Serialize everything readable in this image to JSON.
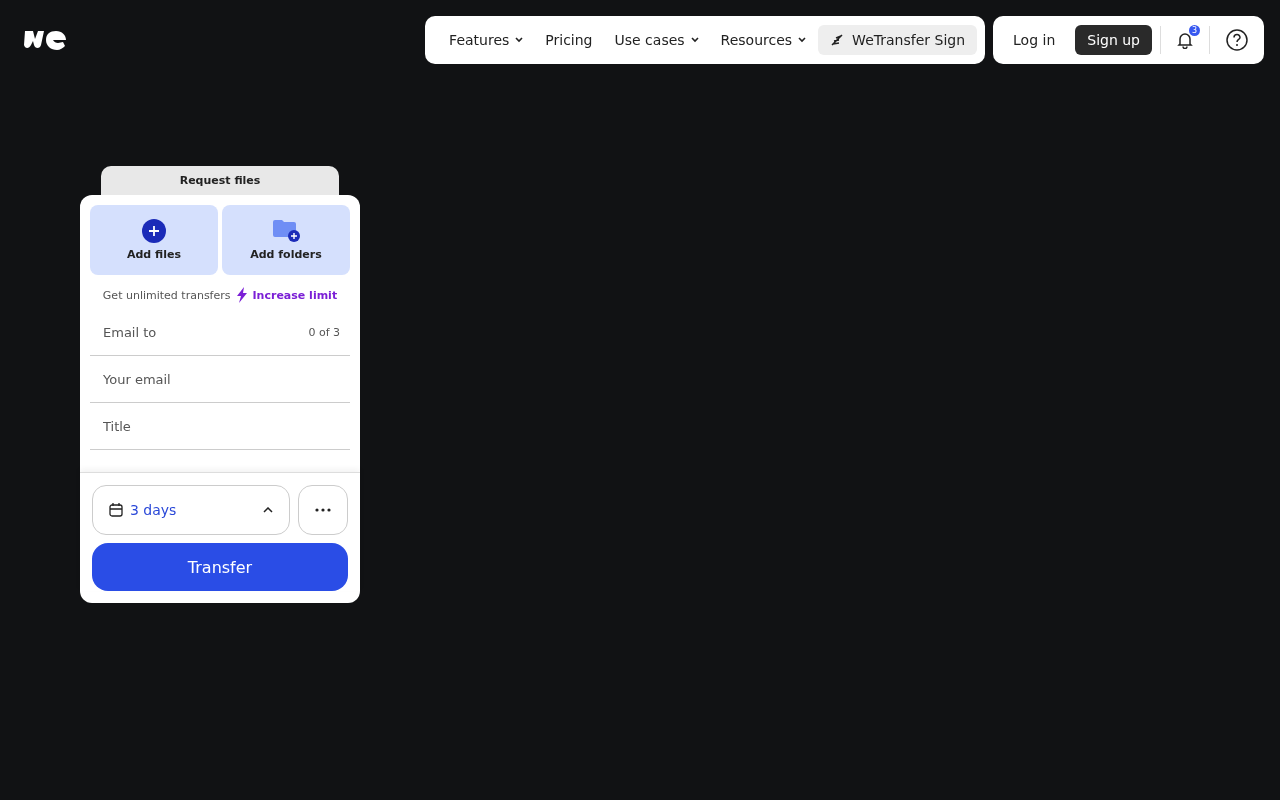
{
  "nav": {
    "items": [
      {
        "label": "Features",
        "has_menu": true
      },
      {
        "label": "Pricing",
        "has_menu": false
      },
      {
        "label": "Use cases",
        "has_menu": true
      },
      {
        "label": "Resources",
        "has_menu": true
      }
    ],
    "sign": "WeTransfer Sign",
    "login": "Log in",
    "signup": "Sign up",
    "notifications": "3"
  },
  "card": {
    "tab": "Request files",
    "add_buttons": [
      {
        "kind": "files",
        "label": "Add files"
      },
      {
        "kind": "folders",
        "label": "Add folders"
      }
    ],
    "promo": {
      "text": "Get unlimited transfers",
      "link": "Increase limit"
    },
    "fields": [
      {
        "placeholder": "Email to",
        "counter": "0 of 3"
      },
      {
        "placeholder": "Your email"
      },
      {
        "placeholder": "Title"
      }
    ],
    "expiry": "3 days",
    "submit": "Transfer"
  }
}
